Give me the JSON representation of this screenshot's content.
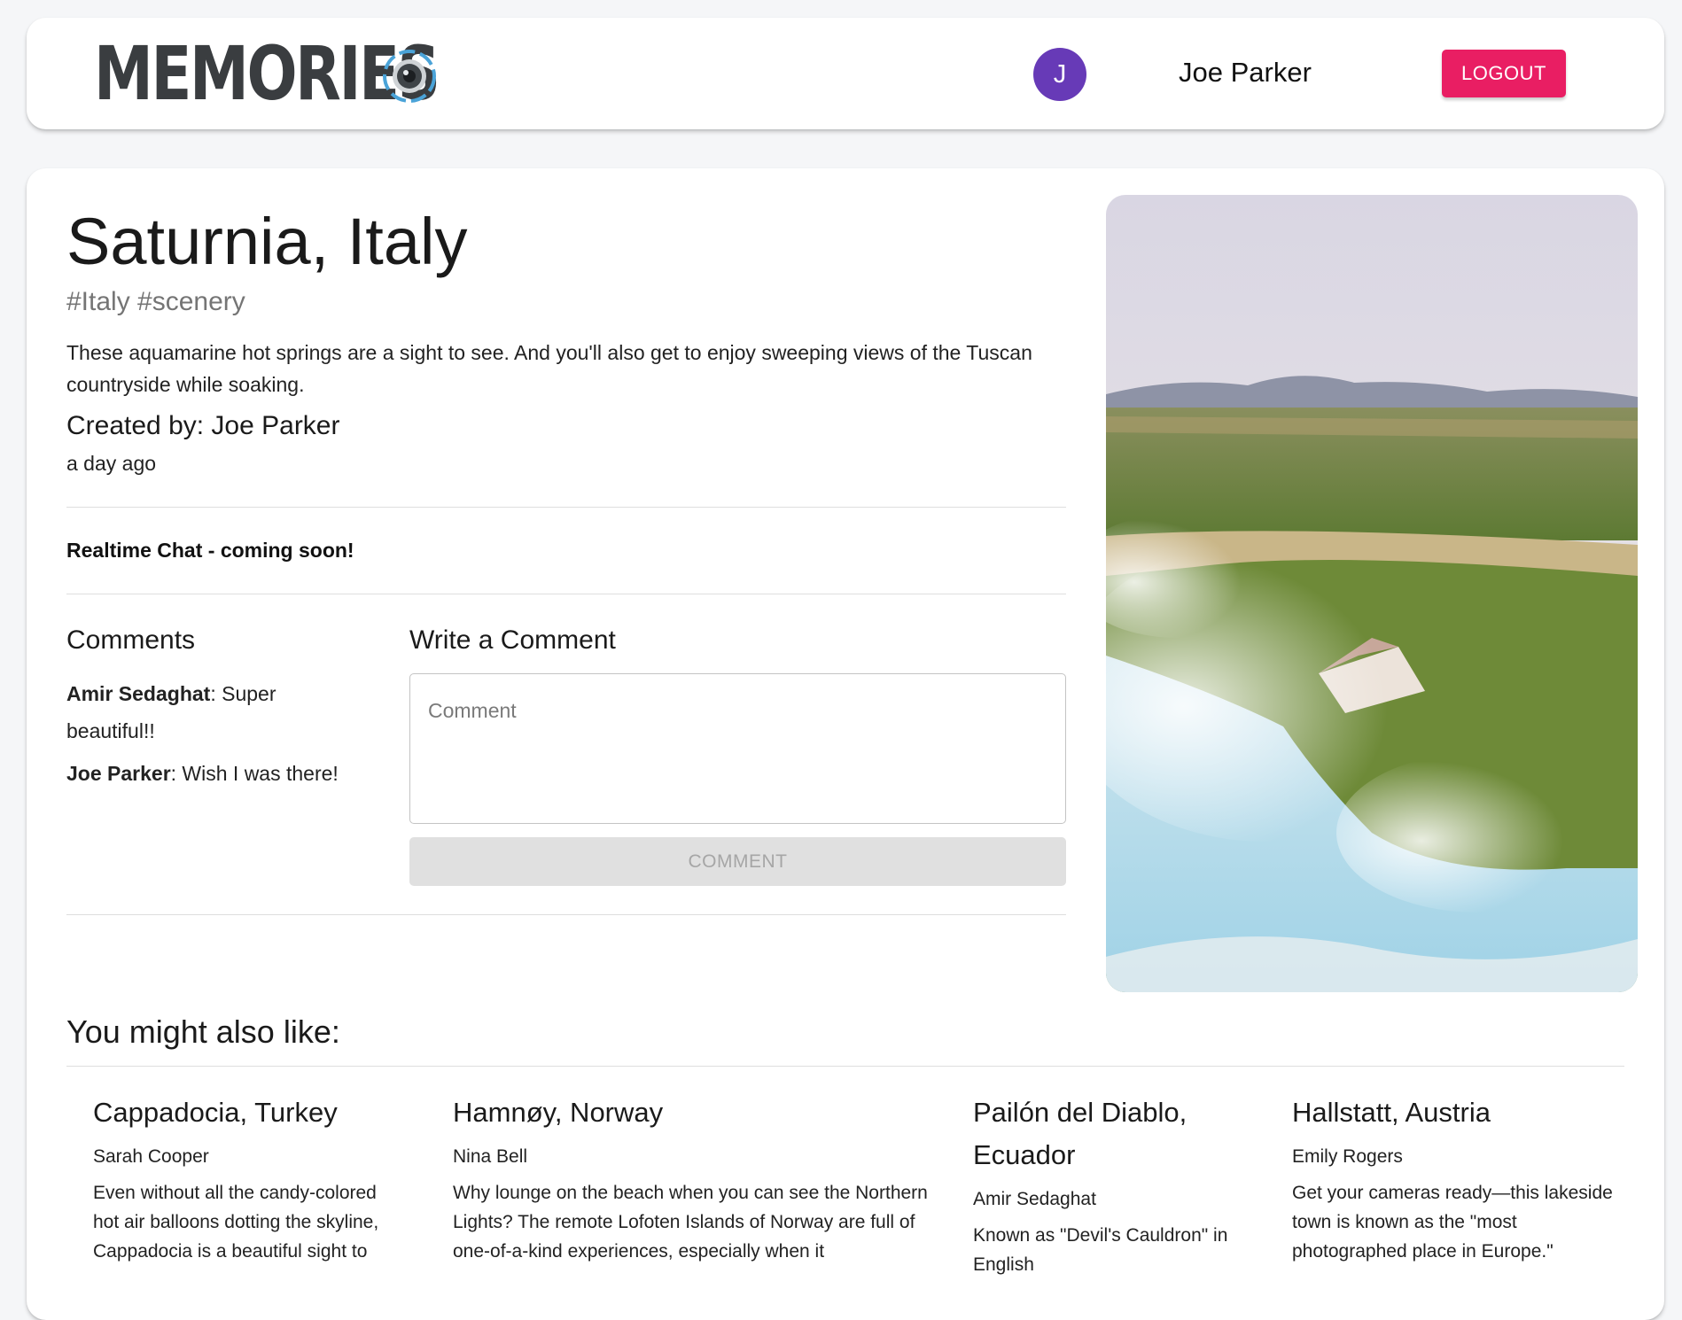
{
  "header": {
    "brand": "MEMORIES",
    "avatar_initial": "J",
    "user_name": "Joe Parker",
    "logout_label": "LOGOUT"
  },
  "post": {
    "title": "Saturnia, Italy",
    "tags": "#Italy #scenery",
    "message": "These aquamarine hot springs are a sight to see. And you'll also get to enjoy sweeping views of the Tuscan countryside while soaking.",
    "created_by": "Created by: Joe Parker",
    "time": "a day ago",
    "chat_notice": "Realtime Chat - coming soon!"
  },
  "comments": {
    "heading": "Comments",
    "items": [
      {
        "author": "Amir Sedaghat",
        "text": ": Super beautiful!!"
      },
      {
        "author": "Joe Parker",
        "text": ": Wish I was there!"
      }
    ],
    "write_heading": "Write a Comment",
    "input_placeholder": "Comment",
    "submit_label": "COMMENT"
  },
  "recommended": {
    "heading": "You might also like:",
    "items": [
      {
        "title": "Cappadocia, Turkey",
        "author": "Sarah Cooper",
        "message": "Even without all the candy-colored hot air balloons dotting the skyline, Cappadocia is a beautiful sight to"
      },
      {
        "title": "Hamnøy, Norway",
        "author": "Nina Bell",
        "message": "Why lounge on the beach when you can see the Northern Lights? The remote Lofoten Islands of Norway are full of one-of-a-kind experiences, especially when it"
      },
      {
        "title": "Pailón del Diablo, Ecuador",
        "author": "Amir Sedaghat",
        "message": "Known as \"Devil's Cauldron\" in English"
      },
      {
        "title": "Hallstatt, Austria",
        "author": "Emily Rogers",
        "message": "Get your cameras ready—this lakeside town is known as the \"most photographed place in Europe.\""
      }
    ]
  },
  "colors": {
    "avatar": "#673ab7",
    "logout": "#e91e63",
    "disabled_button": "#e0e0e0"
  },
  "icons": {
    "brand_icon": "camera-lens-icon"
  }
}
